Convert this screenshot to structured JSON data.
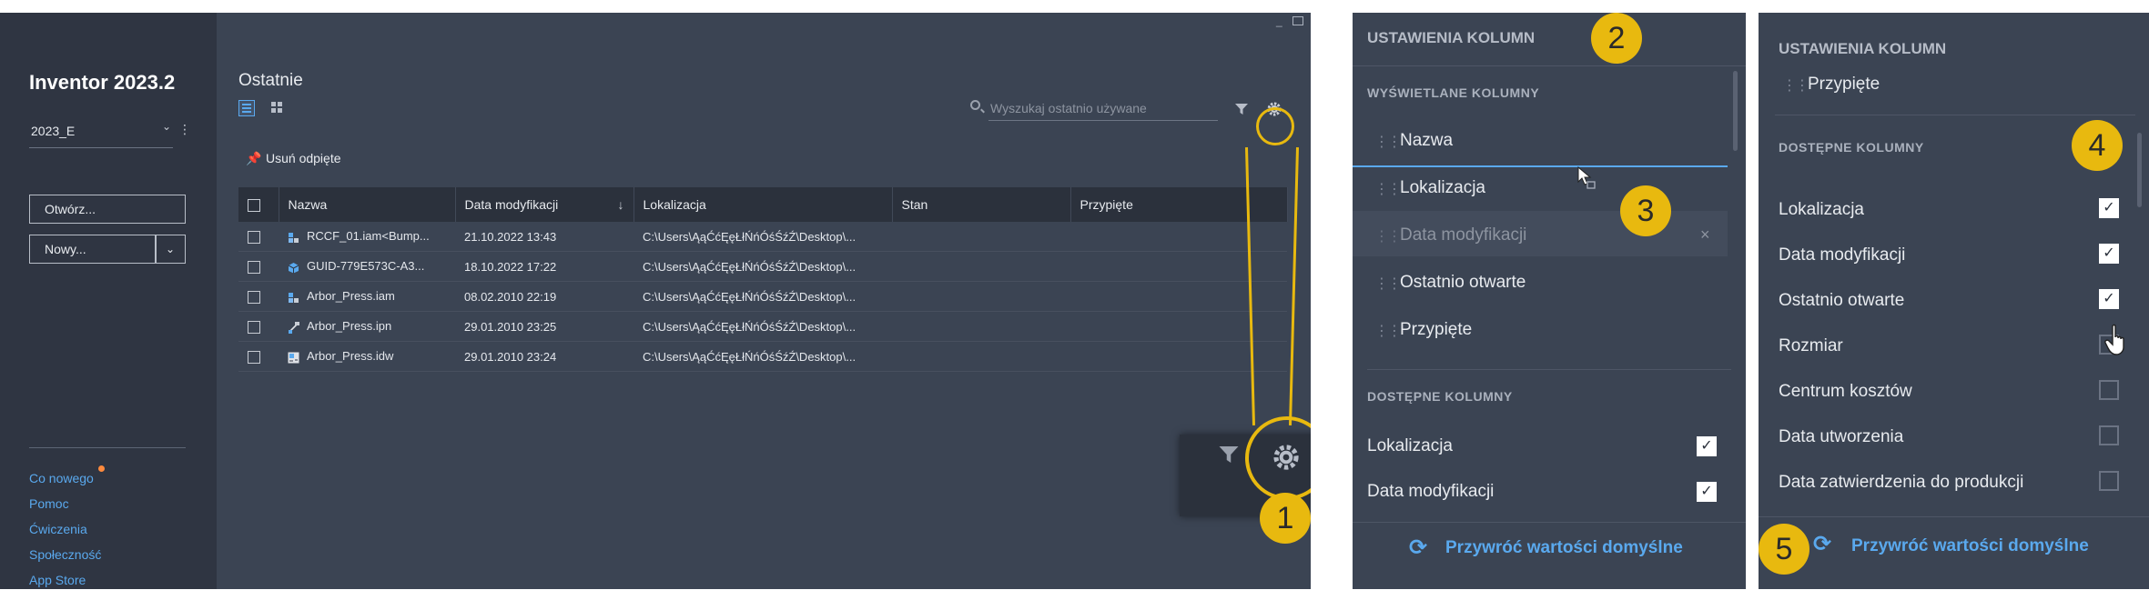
{
  "sidebar": {
    "app_title": "Inventor 2023.2",
    "project": "2023_E",
    "open_button": "Otwórz...",
    "new_button": "Nowy...",
    "links": [
      "Co nowego",
      "Pomoc",
      "Ćwiczenia",
      "Społeczność",
      "App Store"
    ]
  },
  "main": {
    "section_title": "Ostatnie",
    "search_placeholder": "Wyszukaj ostatnio używane",
    "unpin_label": "Usuń odpięte",
    "columns": [
      "Nazwa",
      "Data modyfikacji",
      "Lokalizacja",
      "Stan",
      "Przypięte"
    ],
    "rows": [
      {
        "name": "RCCF_01.iam<Bump...",
        "date": "21.10.2022 13:43",
        "location": "C:\\Users\\ĄąĆćĘęŁłŃńÓśŚźŹ\\Desktop\\...",
        "icon": "assembly-icon"
      },
      {
        "name": "GUID-779E573C-A3...",
        "date": "18.10.2022 17:22",
        "location": "C:\\Users\\ĄąĆćĘęŁłŃńÓśŚźŹ\\Desktop\\...",
        "icon": "part-icon"
      },
      {
        "name": "Arbor_Press.iam",
        "date": "08.02.2010 22:19",
        "location": "C:\\Users\\ĄąĆćĘęŁłŃńÓśŚźŹ\\Desktop\\...",
        "icon": "assembly-icon"
      },
      {
        "name": "Arbor_Press.ipn",
        "date": "29.01.2010 23:25",
        "location": "C:\\Users\\ĄąĆćĘęŁłŃńÓśŚźŹ\\Desktop\\...",
        "icon": "presentation-icon"
      },
      {
        "name": "Arbor_Press.idw",
        "date": "29.01.2010 23:24",
        "location": "C:\\Users\\ĄąĆćĘęŁłŃńÓśŚźŹ\\Desktop\\...",
        "icon": "drawing-icon"
      }
    ]
  },
  "panel2": {
    "header": "USTAWIENIA KOLUMN",
    "displayed_header": "WYŚWIETLANE KOLUMNY",
    "displayed": [
      "Nazwa",
      "Lokalizacja",
      "Data modyfikacji",
      "Ostatnio otwarte",
      "Przypięte"
    ],
    "available_header": "DOSTĘPNE KOLUMNY",
    "available": [
      {
        "label": "Lokalizacja",
        "checked": true
      },
      {
        "label": "Data modyfikacji",
        "checked": true
      }
    ],
    "restore": "Przywróć wartości domyślne"
  },
  "panel3": {
    "header": "USTAWIENIA KOLUMN",
    "pinned_item": "Przypięte",
    "available_header": "DOSTĘPNE KOLUMNY",
    "available": [
      {
        "label": "Lokalizacja",
        "checked": true
      },
      {
        "label": "Data modyfikacji",
        "checked": true
      },
      {
        "label": "Ostatnio otwarte",
        "checked": true
      },
      {
        "label": "Rozmiar",
        "checked": false
      },
      {
        "label": "Centrum kosztów",
        "checked": false
      },
      {
        "label": "Data utworzenia",
        "checked": false
      },
      {
        "label": "Data zatwierdzenia do produkcji",
        "checked": false
      }
    ],
    "restore": "Przywróć wartości domyślne"
  },
  "badges": [
    "1",
    "2",
    "3",
    "4",
    "5"
  ],
  "colors": {
    "accent": "#5aa9ee",
    "callout": "#e8b90f",
    "window_bg": "#3b4453",
    "sidebar_bg": "#2f3542"
  }
}
